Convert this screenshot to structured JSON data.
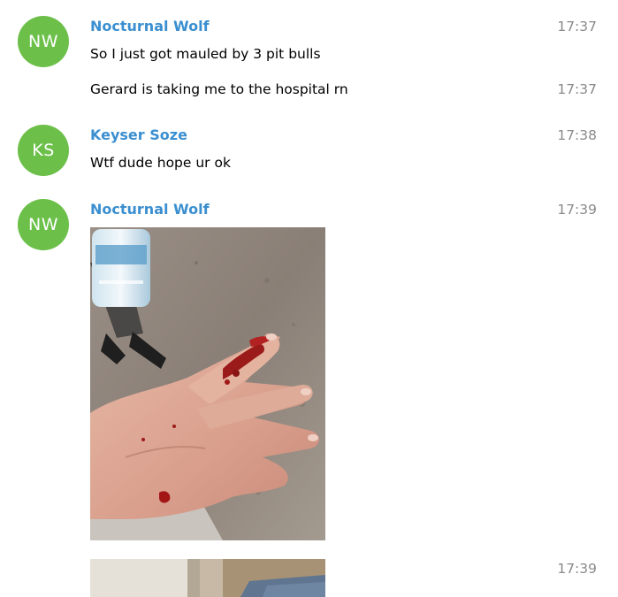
{
  "messages": [
    {
      "avatar_initials": "NW",
      "sender": "Nocturnal Wolf",
      "time": "17:37",
      "text": "So I just got mauled by 3 pit bulls"
    },
    {
      "time": "17:37",
      "text": "Gerard is taking me to the hospital rn"
    },
    {
      "avatar_initials": "KS",
      "sender": "Keyser Soze",
      "time": "17:38",
      "text": "Wtf dude hope ur ok"
    },
    {
      "avatar_initials": "NW",
      "sender": "Nocturnal Wolf",
      "time": "17:39",
      "attachment": "photo"
    },
    {
      "time": "17:39",
      "attachment": "photo"
    }
  ],
  "colors": {
    "avatar_bg": "#6cc04a",
    "sender_name": "#3b8fd0",
    "timestamp": "#8a8a8a",
    "text": "#000000"
  }
}
